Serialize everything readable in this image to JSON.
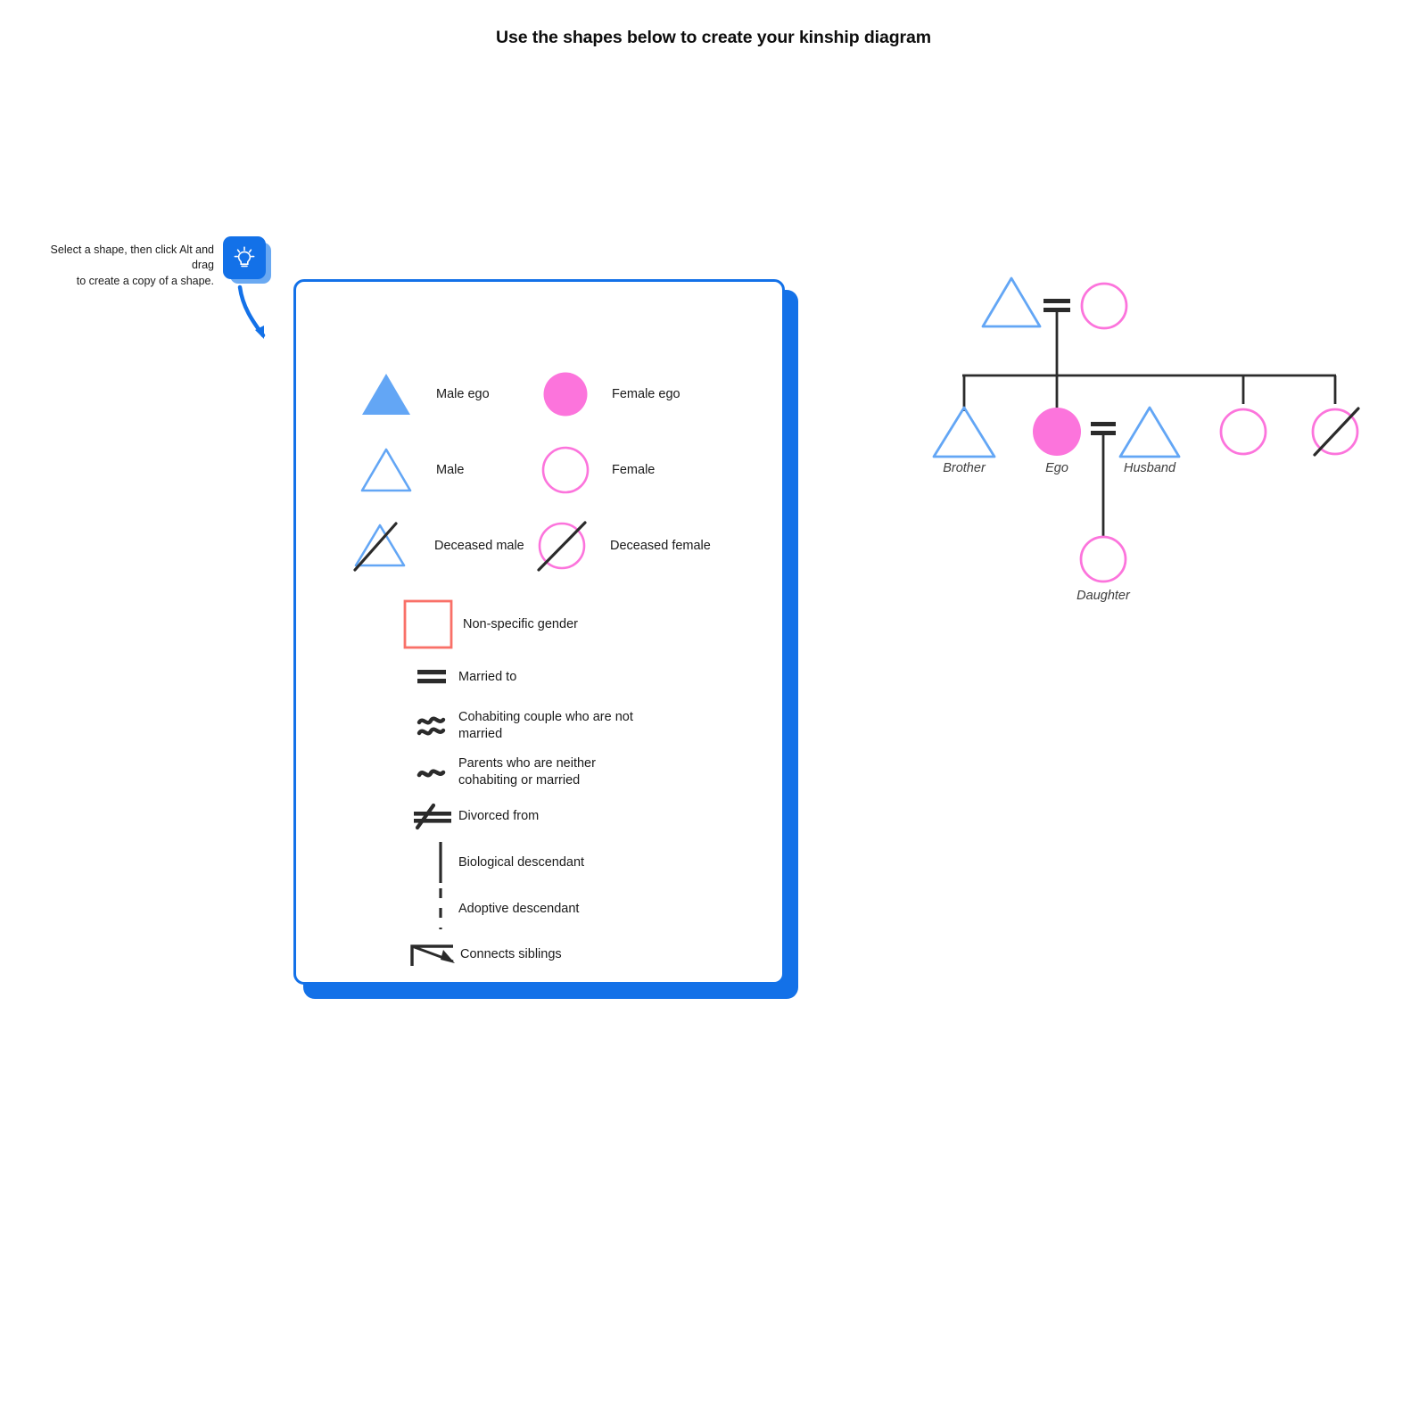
{
  "hint": {
    "icon": "lightbulb-icon",
    "line1": "Select a shape, then click Alt and drag",
    "line2": "to create a copy of a shape."
  },
  "card": {
    "title": "Use the shapes below to create your kinship diagram",
    "border_color": "#1371e8",
    "legend": {
      "shapes": [
        {
          "id": "male-ego",
          "label": "Male ego",
          "glyph": "triangle-filled",
          "color": "#63a6f5"
        },
        {
          "id": "female-ego",
          "label": "Female ego",
          "glyph": "circle-filled",
          "color": "#fc74dc"
        },
        {
          "id": "male",
          "label": "Male",
          "glyph": "triangle-outline",
          "color": "#63a6f5"
        },
        {
          "id": "female",
          "label": "Female",
          "glyph": "circle-outline",
          "color": "#fc74dc"
        },
        {
          "id": "deceased-male",
          "label": "Deceased male",
          "glyph": "triangle-slashed",
          "color": "#63a6f5"
        },
        {
          "id": "deceased-female",
          "label": "Deceased female",
          "glyph": "circle-slashed",
          "color": "#fc74dc"
        },
        {
          "id": "non-specific",
          "label": "Non-specific gender",
          "glyph": "square-outline",
          "color": "#f97068"
        }
      ],
      "relations": [
        {
          "id": "married-to",
          "label": "Married to",
          "glyph": "equals-symbol"
        },
        {
          "id": "cohabiting",
          "label": "Cohabiting couple who are not\nmarried",
          "glyph": "double-tilde-symbol"
        },
        {
          "id": "not-together",
          "label": "Parents who are neither\ncohabiting or married",
          "glyph": "tilde-symbol"
        },
        {
          "id": "divorced",
          "label": "Divorced from",
          "glyph": "not-equals-symbol"
        },
        {
          "id": "biological",
          "label": "Biological descendant",
          "glyph": "solid-line-symbol"
        },
        {
          "id": "adoptive",
          "label": "Adoptive descendant",
          "glyph": "dashed-line-symbol"
        },
        {
          "id": "siblings",
          "label": "Connects siblings",
          "glyph": "sibling-bracket-symbol"
        }
      ]
    }
  },
  "diagram": {
    "line_color": "#2b2b2b",
    "nodes": [
      {
        "id": "father",
        "shape": "triangle-outline",
        "label": "",
        "color": "#63a6f5"
      },
      {
        "id": "mother",
        "shape": "circle-outline",
        "label": "",
        "color": "#fc74dc"
      },
      {
        "id": "brother",
        "shape": "triangle-outline",
        "label": "Brother",
        "color": "#63a6f5"
      },
      {
        "id": "ego",
        "shape": "circle-filled",
        "label": "Ego",
        "color": "#fc74dc"
      },
      {
        "id": "husband",
        "shape": "triangle-outline",
        "label": "Husband",
        "color": "#63a6f5"
      },
      {
        "id": "sister",
        "shape": "circle-outline",
        "label": "",
        "color": "#fc74dc"
      },
      {
        "id": "deceased-sister",
        "shape": "circle-slashed",
        "label": "",
        "color": "#fc74dc"
      },
      {
        "id": "daughter",
        "shape": "circle-outline",
        "label": "Daughter",
        "color": "#fc74dc"
      }
    ],
    "unions": [
      {
        "id": "parents-union",
        "symbol": "="
      },
      {
        "id": "ego-union",
        "symbol": "="
      }
    ]
  }
}
